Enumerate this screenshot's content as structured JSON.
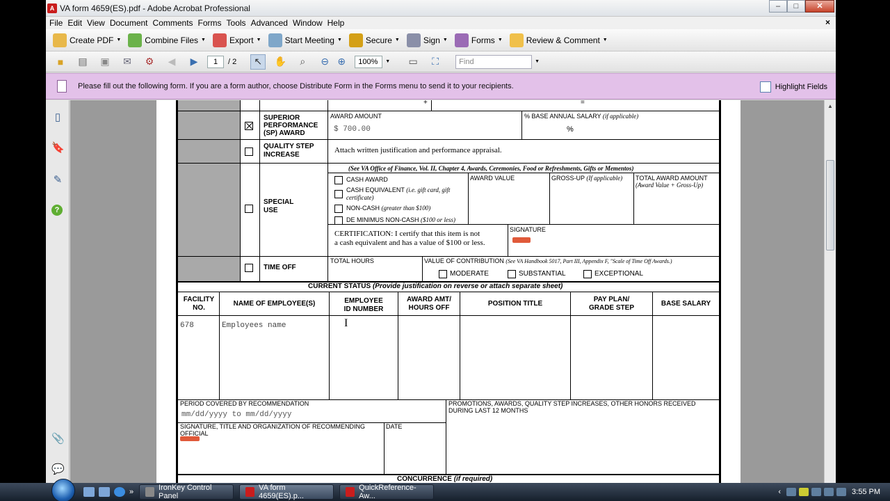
{
  "window": {
    "title": "VA form 4659(ES).pdf - Adobe Acrobat Professional",
    "controls": {
      "minimize": "–",
      "maximize": "□",
      "close": "✕"
    }
  },
  "menu": [
    "File",
    "Edit",
    "View",
    "Document",
    "Comments",
    "Forms",
    "Tools",
    "Advanced",
    "Window",
    "Help"
  ],
  "menu_close": "×",
  "toolbar": {
    "create_pdf": "Create PDF",
    "combine_files": "Combine Files",
    "export": "Export",
    "start_meeting": "Start Meeting",
    "secure": "Secure",
    "sign": "Sign",
    "forms": "Forms",
    "review_comment": "Review & Comment"
  },
  "nav": {
    "page_current": "1",
    "page_total": "/ 2",
    "zoom": "100%",
    "find_placeholder": "Find"
  },
  "notice": {
    "text": "Please fill out the following form. If you are a form author, choose Distribute Form in the Forms menu to send it to your recipients.",
    "highlight_fields": "Highlight Fields"
  },
  "form": {
    "plus_sign": "+",
    "equals_sign": "=",
    "sp_award": "SUPERIOR\nPERFORMANCE\n(SP) AWARD",
    "sp_award_l1": "SUPERIOR",
    "sp_award_l2": "PERFORMANCE",
    "sp_award_l3": "(SP) AWARD",
    "award_amount_label": "AWARD AMOUNT",
    "award_amount_value": "$  700.00",
    "base_salary_pct_label": "% BASE ANNUAL SALARY",
    "if_applicable": "(if applicable)",
    "pct_sign": "%",
    "qsi_l1": "QUALITY STEP",
    "qsi_l2": "INCREASE",
    "qsi_text": "Attach written justification and performance appraisal.",
    "special_l1": "SPECIAL",
    "special_l2": "USE",
    "special_ref": "(See VA Office of Finance, Vol. II, Chapter 4, Awards, Ceremonies, Food or Refreshments, Gifts or Mementos)",
    "cash_award": "CASH AWARD",
    "cash_equiv": "CASH EQUIVALENT",
    "cash_equiv_note": "(i.e. gift card, gift",
    "cash_equiv_note2": "certificate)",
    "non_cash": "NON-CASH",
    "non_cash_note": "(greater than $100)",
    "de_minimus": "DE MINIMUS NON-CASH",
    "de_minimus_note": "($100 or less)",
    "award_value": "AWARD VALUE",
    "gross_up": "GROSS-UP",
    "gross_up_note": "(If applicable)",
    "total_award": "TOTAL AWARD AMOUNT",
    "total_award_note": "(Award Value + Gross-Up)",
    "certification_l1": "CERTIFICATION:  I certify that this item is not",
    "certification_l2": "a cash equivalent and has a value of $100 or less.",
    "signature": "SIGNATURE",
    "time_off": "TIME OFF",
    "total_hours": "TOTAL HOURS",
    "value_contribution": "VALUE OF CONTRIBUTION",
    "value_contribution_ref": "(See VA Handbook 5017, Part III, Appendix F, \"Scale of Time Off Awards.)",
    "moderate": "MODERATE",
    "substantial": "SUBSTANTIAL",
    "exceptional": "EXCEPTIONAL",
    "current_status": "CURRENT STATUS",
    "current_status_note": "(Provide justification on reverse or attach separate sheet)",
    "col_facility_l1": "FACILITY",
    "col_facility_l2": "NO.",
    "col_name": "NAME OF EMPLOYEE(S)",
    "col_empid_l1": "EMPLOYEE",
    "col_empid_l2": "ID NUMBER",
    "col_award_l1": "AWARD AMT/",
    "col_award_l2": "HOURS OFF",
    "col_position": "POSITION TITLE",
    "col_payplan_l1": "PAY PLAN/",
    "col_payplan_l2": "GRADE STEP",
    "col_base_salary": "BASE SALARY",
    "facility_value": "678",
    "name_value": "Employees name",
    "period_label": "PERIOD COVERED BY RECOMMENDATION",
    "period_value": "mm/dd/yyyy to mm/dd/yyyy",
    "promotions_l1": "PROMOTIONS, AWARDS, QUALITY STEP INCREASES, OTHER HONORS RECEIVED",
    "promotions_l2": "DURING LAST 12 MONTHS",
    "sig_official_l1": "SIGNATURE, TITLE AND ORGANIZATION OF RECOMMENDING",
    "sig_official_l2": "OFFICIAL",
    "date": "DATE",
    "concurrence": "CONCURRENCE",
    "concurrence_note": "(if required)"
  },
  "taskbar": {
    "items": [
      "IronKey Control Panel",
      "VA form 4659(ES).p...",
      "QuickReference-Aw..."
    ],
    "clock": "3:55 PM",
    "overflow": "»"
  }
}
